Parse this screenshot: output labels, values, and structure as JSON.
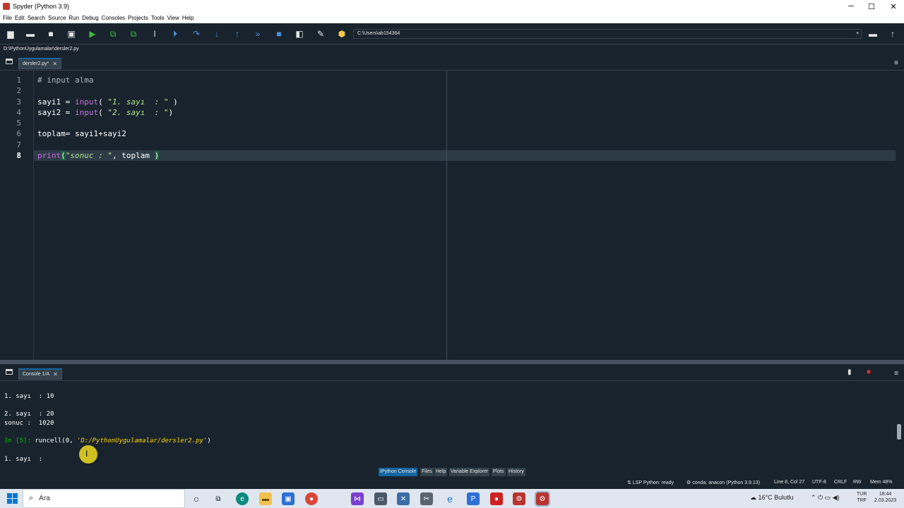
{
  "window": {
    "title": "Spyder (Python 3.9)",
    "controls": {
      "minimize": "─",
      "maximize": "☐",
      "close": "✕"
    }
  },
  "menu": [
    "File",
    "Edit",
    "Search",
    "Source",
    "Run",
    "Debug",
    "Consoles",
    "Projects",
    "Tools",
    "View",
    "Help"
  ],
  "toolbar": {
    "working_dir": "C:\\Users\\ab154364",
    "icons": [
      "new-file-icon",
      "open-file-icon",
      "save-icon",
      "save-all-icon",
      "run-icon",
      "run-cell-icon",
      "run-cell-advance-icon",
      "run-selection-icon",
      "debug-icon",
      "step-icon",
      "step-into-icon",
      "step-return-icon",
      "continue-icon",
      "stop-icon",
      "maximize-pane-icon",
      "preferences-icon",
      "python-path-icon"
    ]
  },
  "editor": {
    "file_path": "D:\\PythonUygulamalar\\dersler2.py",
    "tab_label": "dersler2.py*",
    "line_numbers": [
      "1",
      "2",
      "3",
      "4",
      "5",
      "6",
      "7",
      "8"
    ],
    "current_line": "8",
    "lines": {
      "l1": "# input alma",
      "l3_a": "sayi1 = ",
      "l3_fn": "input",
      "l3_b": "( ",
      "l3_str": "\"1. sayı  : \"",
      "l3_c": " )",
      "l4_a": "sayi2 = ",
      "l4_fn": "input",
      "l4_b": "( ",
      "l4_str": "\"2. sayı  : \"",
      "l4_c": ")",
      "l6": "toplam= sayi1+sayi2",
      "l8_fn": "print",
      "l8_open": "(",
      "l8_str": "\"sonuc : \"",
      "l8_b": ", toplam ",
      "l8_close": ")"
    }
  },
  "console": {
    "tab_label": "Console 1/A",
    "output": {
      "o1": "1. sayı  : 10",
      "o2": "2. sayı  : 20",
      "o3": "sonuc :  1020",
      "prompt": "In [5]: ",
      "cmd_a": "runcell(0, ",
      "cmd_path": "'D:/PythonUygulamalar/dersler2.py'",
      "cmd_b": ")",
      "o4": "1. sayı  :"
    }
  },
  "bottom_tabs": [
    "IPython Console",
    "Files",
    "Help",
    "Variable Explorer",
    "Plots",
    "History"
  ],
  "active_bottom_tab": "IPython Console",
  "status": {
    "lsp": "LSP Python: ready",
    "conda": "conda: anacon (Python 3.9.13)",
    "position": "Line 8, Col 27",
    "encoding": "UTF-8",
    "eol": "CRLF",
    "rw": "RW",
    "mem": "Mem 48%"
  },
  "taskbar": {
    "search_placeholder": "Ara",
    "weather": "16°C  Bulutlu",
    "lang": "TUR",
    "lang2": "TRF",
    "time": "18:44",
    "date": "2.03.2023",
    "colors": {
      "accent": "#0078d4",
      "background": "#dfe6ef"
    }
  },
  "colors": {
    "editor_bg": "#19232d",
    "keyword_builtin": "#c670e0",
    "string": "#b0e686",
    "console_prompt": "#00c000",
    "console_path": "#ffd700",
    "active_tab": "#1464a0"
  }
}
